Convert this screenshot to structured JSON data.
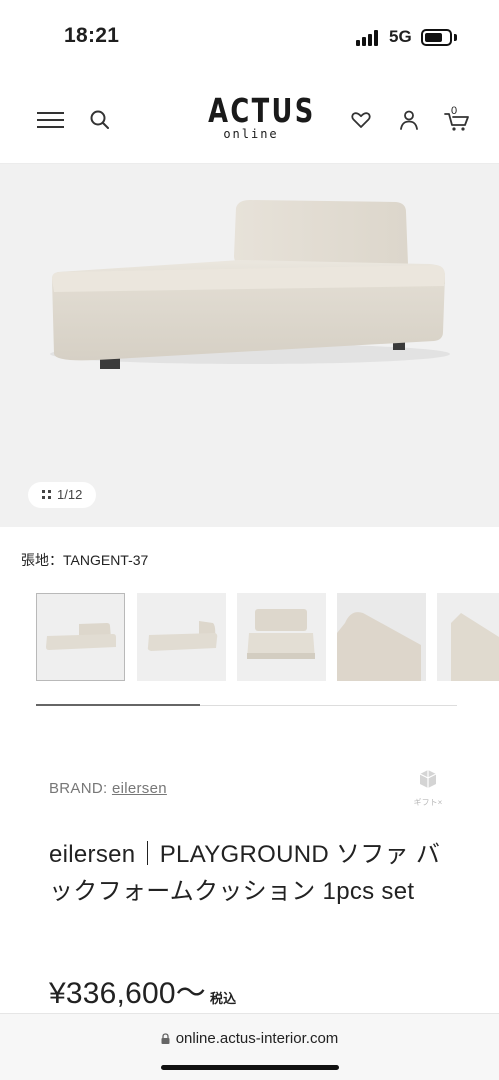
{
  "status_bar": {
    "time": "18:21",
    "network": "5G",
    "icons": [
      "signal-icon",
      "battery-icon"
    ]
  },
  "header": {
    "logo_main": "ACTUS",
    "logo_sub": "online",
    "cart_count": "0",
    "icons": [
      "menu-icon",
      "search-icon",
      "heart-icon",
      "user-icon",
      "cart-icon"
    ]
  },
  "gallery": {
    "counter": "1/12",
    "current_index": 1,
    "total": 12,
    "fabric_label": "張地：TANGENT-37",
    "thumbnail_count_visible": 5,
    "scroll_progress_fraction": 0.39
  },
  "product": {
    "brand_prefix": "BRAND: ",
    "brand_name": "eilersen",
    "gift_label": "ギフト×",
    "title": "eilersen｜PLAYGROUND ソファ バックフォームクッション 1pcs set",
    "price": "¥336,600～",
    "tax_label": "税込"
  },
  "browser": {
    "url": "online.actus-interior.com"
  },
  "colors": {
    "background": "#ffffff",
    "hero_background": "#f1f1f1",
    "sofa_fabric": "#e3ded4",
    "text": "#1f1f1f",
    "muted_text": "#777777"
  }
}
